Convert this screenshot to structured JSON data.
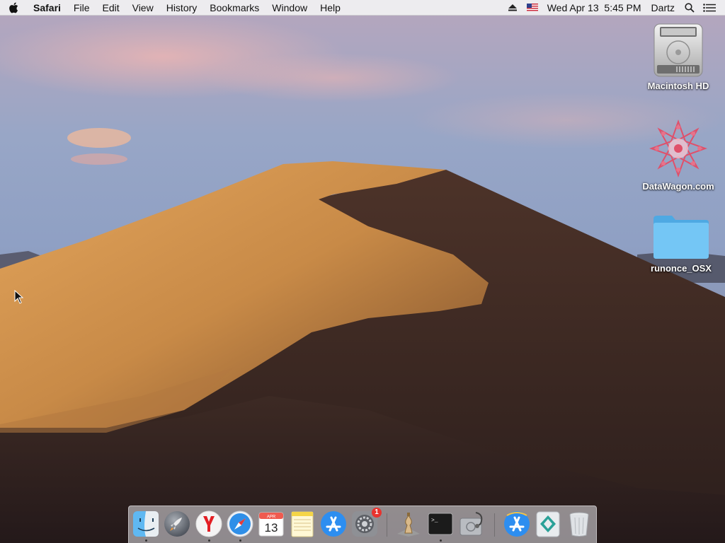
{
  "menubar": {
    "app_name": "Safari",
    "menus": [
      "File",
      "Edit",
      "View",
      "History",
      "Bookmarks",
      "Window",
      "Help"
    ],
    "date": "Wed Apr 13",
    "time": "5:45 PM",
    "user": "Dartz",
    "status_icons": [
      "eject-icon",
      "us-flag-input-icon",
      "spotlight-search-icon",
      "notification-center-icon"
    ]
  },
  "desktop": {
    "icons": [
      {
        "label": "Macintosh HD",
        "icon": "hard-drive-icon"
      },
      {
        "label": "DataWagon.com",
        "icon": "datawagon-logo-icon"
      },
      {
        "label": "runonce_OSX",
        "icon": "folder-icon"
      }
    ]
  },
  "dock": {
    "items": [
      {
        "icon": "finder-icon",
        "running": true
      },
      {
        "icon": "launchpad-icon",
        "running": false
      },
      {
        "icon": "yandex-browser-icon",
        "running": true
      },
      {
        "icon": "safari-icon",
        "running": true
      },
      {
        "icon": "calendar-icon",
        "running": false,
        "month": "APR",
        "day": "13"
      },
      {
        "icon": "notes-icon",
        "running": false
      },
      {
        "icon": "app-store-icon",
        "running": false
      },
      {
        "icon": "system-preferences-icon",
        "running": false,
        "badge": "1"
      },
      {
        "icon": "chess-icon",
        "running": false
      },
      {
        "icon": "terminal-icon",
        "running": true,
        "prompt": ">_"
      },
      {
        "icon": "disk-utility-icon",
        "running": false
      },
      {
        "icon": "app-store-downloads-icon",
        "running": false
      },
      {
        "icon": "webex-icon",
        "running": false
      },
      {
        "icon": "trash-icon",
        "running": false
      }
    ]
  },
  "colors": {
    "menubar_bg": "#f0f0f2",
    "badge": "#e8332e",
    "folder": "#6fc3f3"
  }
}
